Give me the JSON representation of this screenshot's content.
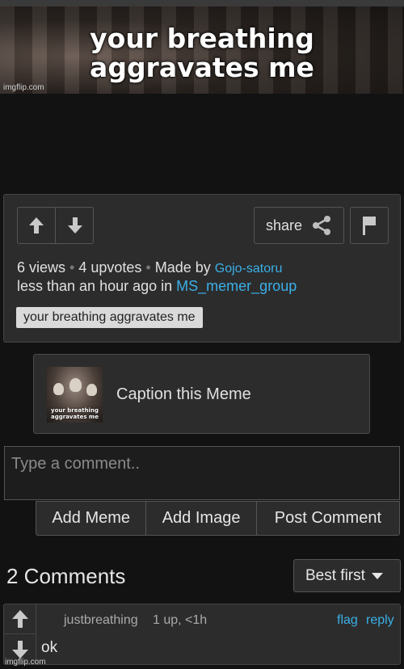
{
  "meme": {
    "caption_line1": "your breathing",
    "caption_line2": "aggravates me",
    "watermark": "imgflip.com"
  },
  "post": {
    "views": "6 views",
    "upvotes": "4 upvotes",
    "made_by_label": "Made by",
    "author": "Gojo-satoru",
    "time_prefix": "less than an hour ago in",
    "stream": "MS_memer_group",
    "share_label": "share",
    "tag": "your breathing aggravates me"
  },
  "caption_this": {
    "label": "Caption this Meme",
    "thumb_text": "your breathing aggravates me"
  },
  "comment_form": {
    "placeholder": "Type a comment..",
    "buttons": [
      "Add Meme",
      "Add Image",
      "Post Comment"
    ]
  },
  "comments": {
    "title": "2 Comments",
    "sort_label": "Best first",
    "items": [
      {
        "user": "justbreathing",
        "score": "1 up, <1h",
        "flag": "flag",
        "reply": "reply",
        "text": "ok"
      }
    ],
    "watermark": "imgflip.com"
  },
  "colors": {
    "background": "#121212",
    "panel": "#2c2c2c",
    "link": "#3ab0e8"
  }
}
